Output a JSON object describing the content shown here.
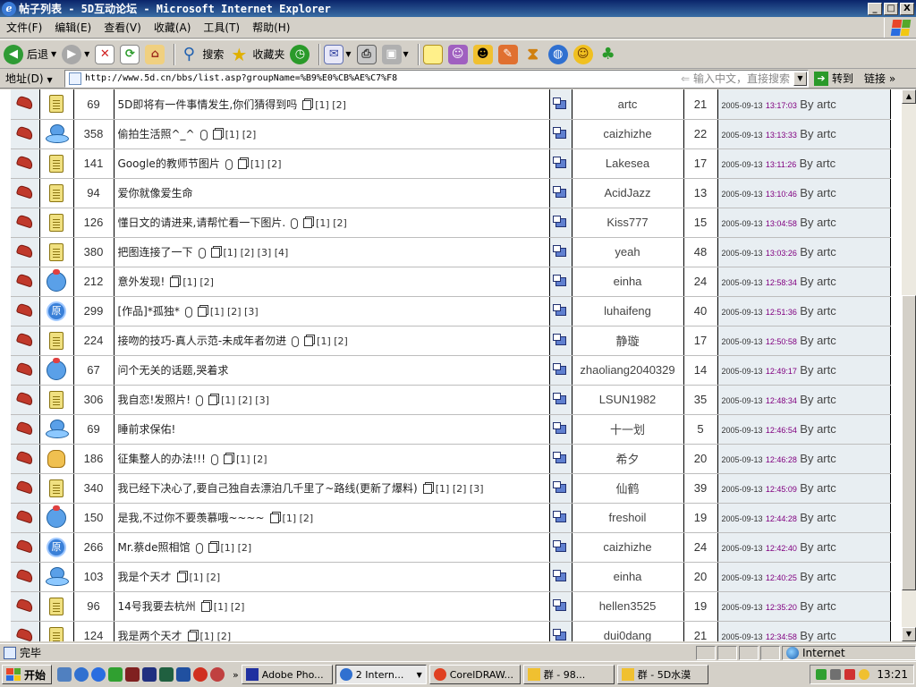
{
  "window": {
    "title": "帖子列表 - 5D互动论坛 - Microsoft Internet Explorer",
    "min": "_",
    "max": "□",
    "close": "X"
  },
  "menu": [
    "文件(F)",
    "编辑(E)",
    "查看(V)",
    "收藏(A)",
    "工具(T)",
    "帮助(H)"
  ],
  "toolbar": {
    "back": "后退",
    "search": "搜索",
    "favorites": "收藏夹"
  },
  "address": {
    "label": "地址(D)",
    "url": "http://www.5d.cn/bbs/list.asp?groupName=%B9%E0%CB%AE%C7%F8",
    "hint": "输入中文，直接搜索",
    "go": "转到",
    "links": "链接"
  },
  "threads": [
    {
      "icon": "note",
      "views": "69",
      "title": "5D即将有一件事情发生,你们猜得到吗",
      "clip": false,
      "pages": "[1] [2]",
      "author": "artc",
      "replies": "21",
      "date": "2005-09-13",
      "time": "13:17:03",
      "by": "By artc"
    },
    {
      "icon": "ufo",
      "views": "358",
      "title": "偷拍生活照^_^",
      "clip": true,
      "pages": "[1] [2]",
      "author": "caizhizhe",
      "replies": "22",
      "date": "2005-09-13",
      "time": "13:13:33",
      "by": "By artc"
    },
    {
      "icon": "note",
      "views": "141",
      "title": "Google的教师节图片",
      "clip": true,
      "pages": "[1] [2]",
      "author": "Lakesea",
      "replies": "17",
      "date": "2005-09-13",
      "time": "13:11:26",
      "by": "By artc"
    },
    {
      "icon": "note",
      "views": "94",
      "title": "爱你就像爱生命",
      "clip": false,
      "pages": "",
      "author": "AcidJazz",
      "replies": "13",
      "date": "2005-09-13",
      "time": "13:10:46",
      "by": "By artc"
    },
    {
      "icon": "note",
      "views": "126",
      "title": "懂日文的请进来,请帮忙看一下图片.",
      "clip": true,
      "pages": "[1] [2]",
      "author": "Kiss777",
      "replies": "15",
      "date": "2005-09-13",
      "time": "13:04:58",
      "by": "By artc"
    },
    {
      "icon": "note",
      "views": "380",
      "title": "把图连接了一下",
      "clip": true,
      "pages": "[1] [2] [3] [4]",
      "author": "yeah",
      "replies": "48",
      "date": "2005-09-13",
      "time": "13:03:26",
      "by": "By artc"
    },
    {
      "icon": "robot",
      "views": "212",
      "title": "意外发现!",
      "clip": false,
      "pages": "[1] [2]",
      "author": "einha",
      "replies": "24",
      "date": "2005-09-13",
      "time": "12:58:34",
      "by": "By artc"
    },
    {
      "icon": "yuan",
      "views": "299",
      "title": "[作品]*孤独*",
      "clip": true,
      "pages": "[1] [2] [3]",
      "author": "luhaifeng",
      "replies": "40",
      "date": "2005-09-13",
      "time": "12:51:36",
      "by": "By artc"
    },
    {
      "icon": "note",
      "views": "224",
      "title": "接吻的技巧-真人示范-未成年者勿进",
      "clip": true,
      "pages": "[1] [2]",
      "author": "静璇",
      "replies": "17",
      "date": "2005-09-13",
      "time": "12:50:58",
      "by": "By artc"
    },
    {
      "icon": "robot",
      "views": "67",
      "title": "问个无关的话题,哭着求",
      "clip": false,
      "pages": "",
      "author": "zhaoliang2040329",
      "replies": "14",
      "date": "2005-09-13",
      "time": "12:49:17",
      "by": "By artc"
    },
    {
      "icon": "note",
      "views": "306",
      "title": "我自恋!发照片!",
      "clip": true,
      "pages": "[1] [2] [3]",
      "author": "LSUN1982",
      "replies": "35",
      "date": "2005-09-13",
      "time": "12:48:34",
      "by": "By artc"
    },
    {
      "icon": "ufo",
      "views": "69",
      "title": "睡前求保佑!",
      "clip": false,
      "pages": "",
      "author": "十一划",
      "replies": "5",
      "date": "2005-09-13",
      "time": "12:46:54",
      "by": "By artc"
    },
    {
      "icon": "thumb",
      "views": "186",
      "title": "征集整人的办法!!!",
      "clip": true,
      "pages": "[1] [2]",
      "author": "希夕",
      "replies": "20",
      "date": "2005-09-13",
      "time": "12:46:28",
      "by": "By artc"
    },
    {
      "icon": "note",
      "views": "340",
      "title": "我已经下决心了,要自己独自去漂泊几千里了~路线(更新了爆料)",
      "clip": false,
      "pages": "[1] [2] [3]",
      "author": "仙鹤",
      "replies": "39",
      "date": "2005-09-13",
      "time": "12:45:09",
      "by": "By artc"
    },
    {
      "icon": "robot",
      "views": "150",
      "title": "是我,不过你不要羡慕哦~~~~",
      "clip": false,
      "pages": "[1] [2]",
      "author": "freshoil",
      "replies": "19",
      "date": "2005-09-13",
      "time": "12:44:28",
      "by": "By artc"
    },
    {
      "icon": "yuan",
      "views": "266",
      "title": "Mr.蔡de照相馆",
      "clip": true,
      "pages": "[1] [2]",
      "author": "caizhizhe",
      "replies": "24",
      "date": "2005-09-13",
      "time": "12:42:40",
      "by": "By artc"
    },
    {
      "icon": "ufo",
      "views": "103",
      "title": "我是个天才",
      "clip": false,
      "pages": "[1] [2]",
      "author": "einha",
      "replies": "20",
      "date": "2005-09-13",
      "time": "12:40:25",
      "by": "By artc"
    },
    {
      "icon": "note",
      "views": "96",
      "title": "14号我要去杭州",
      "clip": false,
      "pages": "[1] [2]",
      "author": "hellen3525",
      "replies": "19",
      "date": "2005-09-13",
      "time": "12:35:20",
      "by": "By artc"
    },
    {
      "icon": "note",
      "views": "124",
      "title": "我是两个天才",
      "clip": false,
      "pages": "[1] [2]",
      "author": "dui0dang",
      "replies": "21",
      "date": "2005-09-13",
      "time": "12:34:58",
      "by": "By artc"
    }
  ],
  "status": {
    "text": "完毕",
    "zone": "Internet"
  },
  "taskbar": {
    "start": "开始",
    "buttons": [
      "Adobe Pho...",
      "2 Intern...",
      "CorelDRAW...",
      "群 - 98...",
      "群 - 5D水漠"
    ],
    "clock": "13:21"
  },
  "icon_names": {
    "lock": "reply-shoe-icon",
    "note": "note-icon",
    "ufo": "ufo-icon",
    "yuan": "yuan-badge-icon",
    "thumb": "thumbs-up-icon",
    "robot": "robot-icon"
  }
}
